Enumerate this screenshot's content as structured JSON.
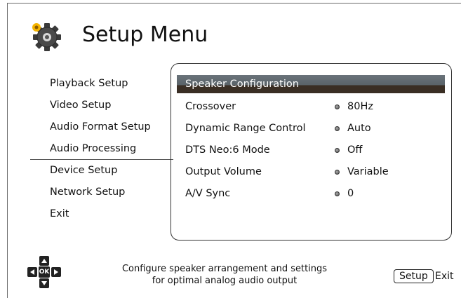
{
  "header": {
    "title": "Setup Menu",
    "icon": "gear-icon"
  },
  "menu": {
    "items": [
      {
        "label": "Playback Setup"
      },
      {
        "label": "Video Setup"
      },
      {
        "label": "Audio Format Setup"
      },
      {
        "label": "Audio Processing",
        "active": true
      },
      {
        "label": "Device Setup"
      },
      {
        "label": "Network Setup"
      },
      {
        "label": "Exit"
      }
    ]
  },
  "panel": {
    "header": "Speaker Configuration",
    "settings": [
      {
        "label": "Crossover",
        "value": "80Hz"
      },
      {
        "label": "Dynamic Range Control",
        "value": "Auto"
      },
      {
        "label": "DTS Neo:6 Mode",
        "value": "Off"
      },
      {
        "label": "Output Volume",
        "value": "Variable"
      },
      {
        "label": "A/V Sync",
        "value": "0"
      }
    ]
  },
  "footer": {
    "nav_icon": "directional-pad-icon",
    "ok_label": "OK",
    "help_line1": "Configure speaker arrangement and settings",
    "help_line2": "for optimal analog audio output",
    "setup_key": "Setup",
    "exit_label": "Exit"
  },
  "colors": {
    "highlight_bar": "#5a6369",
    "highlight_shadow": "#3a2e24"
  }
}
